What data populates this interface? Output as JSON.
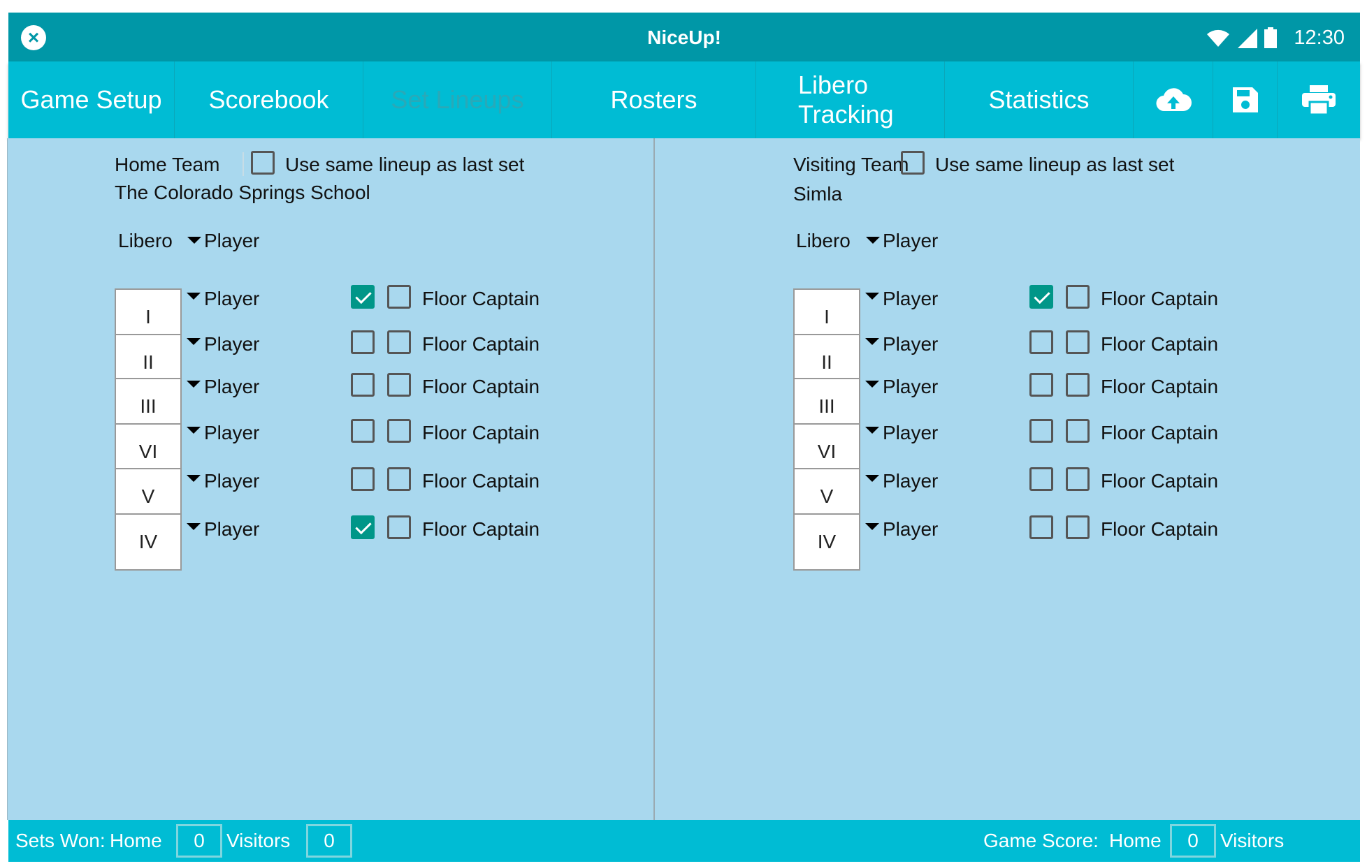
{
  "status_bar": {
    "app_title": "NiceUp!",
    "time": "12:30",
    "icons": [
      "close-icon",
      "wifi-icon",
      "signal-icon",
      "battery-icon"
    ]
  },
  "tabs": [
    {
      "label": "Game Setup"
    },
    {
      "label": "Scorebook"
    },
    {
      "label": "Set Lineups",
      "disabled": true
    },
    {
      "label": "Rosters"
    },
    {
      "label": "Libero Tracking"
    },
    {
      "label": "Statistics"
    }
  ],
  "toolbar_icons": [
    "cloud-upload-icon",
    "save-icon",
    "print-icon"
  ],
  "home": {
    "team_label": "Home Team",
    "same_lineup_label": "Use same lineup as last set",
    "same_lineup_checked": false,
    "team_name": "The Colorado Springs School",
    "libero_label": "Libero",
    "libero_player": "Player",
    "rows": [
      {
        "position": "I",
        "player": "Player",
        "checked": true,
        "captain_label": "Floor Captain",
        "captain": false
      },
      {
        "position": "II",
        "player": "Player",
        "checked": false,
        "captain_label": "Floor Captain",
        "captain": false
      },
      {
        "position": "III",
        "player": "Player",
        "checked": false,
        "captain_label": "Floor Captain",
        "captain": false
      },
      {
        "position": "VI",
        "player": "Player",
        "checked": false,
        "captain_label": "Floor Captain",
        "captain": false
      },
      {
        "position": "V",
        "player": "Player",
        "checked": false,
        "captain_label": "Floor Captain",
        "captain": false
      },
      {
        "position": "IV",
        "player": "Player",
        "checked": true,
        "captain_label": "Floor Captain",
        "captain": false
      }
    ]
  },
  "visitor": {
    "team_label": "Visiting Team",
    "same_lineup_label": "Use same lineup as last set",
    "same_lineup_checked": false,
    "team_name": "Simla",
    "libero_label": "Libero",
    "libero_player": "Player",
    "rows": [
      {
        "position": "I",
        "player": "Player",
        "checked": true,
        "captain_label": "Floor Captain",
        "captain": false
      },
      {
        "position": "II",
        "player": "Player",
        "checked": false,
        "captain_label": "Floor Captain",
        "captain": false
      },
      {
        "position": "III",
        "player": "Player",
        "checked": false,
        "captain_label": "Floor Captain",
        "captain": false
      },
      {
        "position": "VI",
        "player": "Player",
        "checked": false,
        "captain_label": "Floor Captain",
        "captain": false
      },
      {
        "position": "V",
        "player": "Player",
        "checked": false,
        "captain_label": "Floor Captain",
        "captain": false
      },
      {
        "position": "IV",
        "player": "Player",
        "checked": false,
        "captain_label": "Floor Captain",
        "captain": false
      }
    ]
  },
  "bottom_bar": {
    "sets_won_label": "Sets Won:",
    "sets_home_label": "Home",
    "sets_home_value": "0",
    "sets_visitors_label": "Visitors",
    "sets_visitors_value": "0",
    "game_score_label": "Game Score:",
    "score_home_label": "Home",
    "score_home_value": "0",
    "score_visitors_label": "Visitors"
  },
  "colors": {
    "status_bar": "#0097a7",
    "tab_bar": "#00bcd4",
    "panel_bg": "#a9d8ee",
    "check_accent": "#009688"
  }
}
